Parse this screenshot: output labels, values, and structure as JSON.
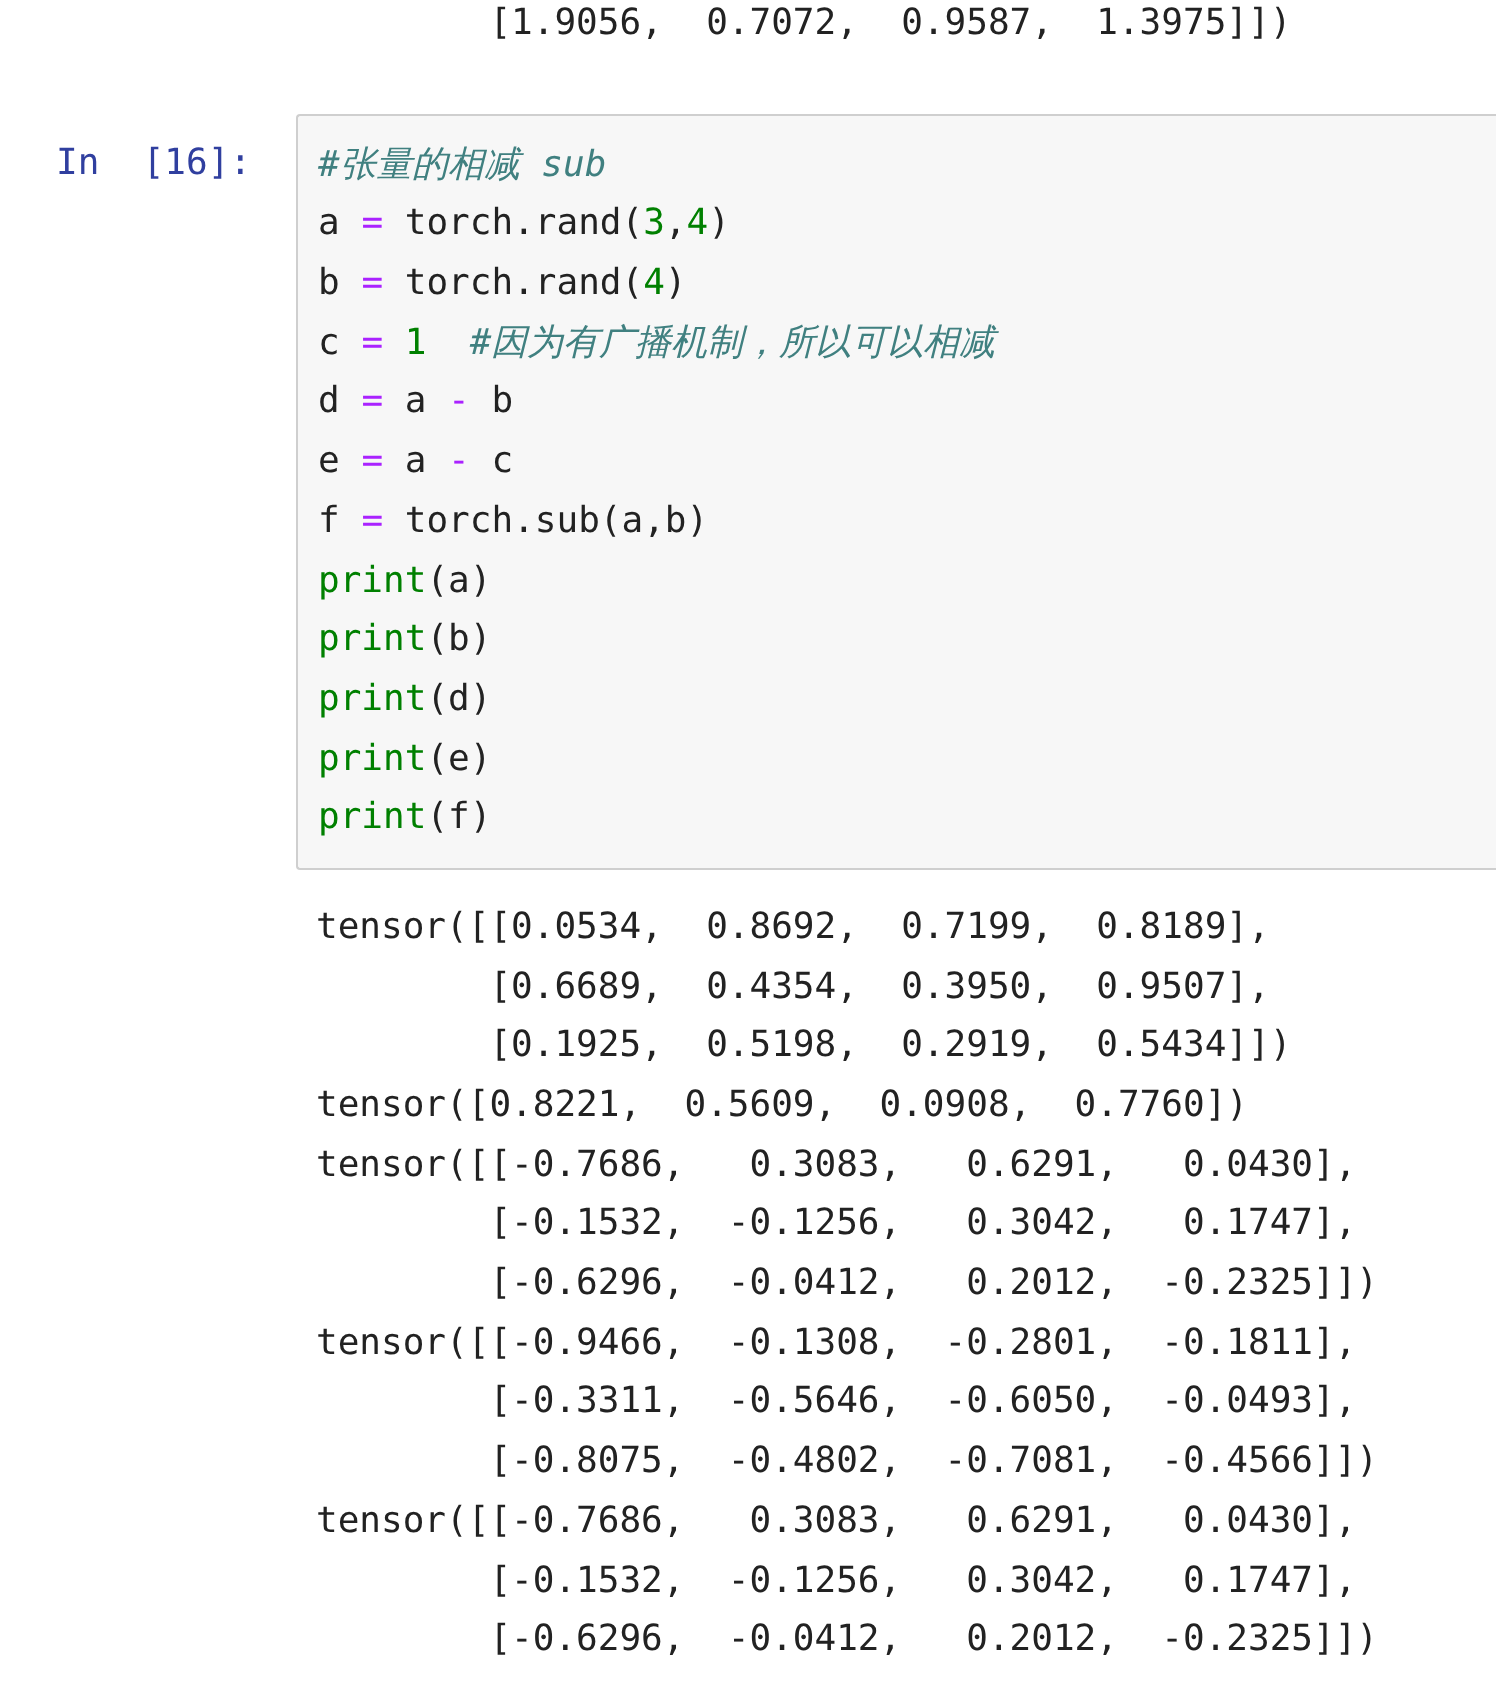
{
  "previous_output": [
    "        [1.9056,  0.7072,  0.9587,  1.3975]])"
  ],
  "cell": {
    "prompt": "In  [16]:",
    "code": [
      [
        {
          "kind": "comment",
          "text": "#张量的相减 sub"
        }
      ],
      [
        {
          "kind": "name",
          "text": "a "
        },
        {
          "kind": "op",
          "text": "="
        },
        {
          "kind": "name",
          "text": " torch.rand("
        },
        {
          "kind": "num",
          "text": "3"
        },
        {
          "kind": "name",
          "text": ","
        },
        {
          "kind": "num",
          "text": "4"
        },
        {
          "kind": "name",
          "text": ")"
        }
      ],
      [
        {
          "kind": "name",
          "text": "b "
        },
        {
          "kind": "op",
          "text": "="
        },
        {
          "kind": "name",
          "text": " torch.rand("
        },
        {
          "kind": "num",
          "text": "4"
        },
        {
          "kind": "name",
          "text": ")"
        }
      ],
      [
        {
          "kind": "name",
          "text": "c "
        },
        {
          "kind": "op",
          "text": "= "
        },
        {
          "kind": "num",
          "text": "1  "
        },
        {
          "kind": "comment",
          "text": "#因为有广播机制，所以可以相减"
        }
      ],
      [
        {
          "kind": "name",
          "text": "d "
        },
        {
          "kind": "op",
          "text": "="
        },
        {
          "kind": "name",
          "text": " a "
        },
        {
          "kind": "op",
          "text": "-"
        },
        {
          "kind": "name",
          "text": " b"
        }
      ],
      [
        {
          "kind": "name",
          "text": "e "
        },
        {
          "kind": "op",
          "text": "="
        },
        {
          "kind": "name",
          "text": " a "
        },
        {
          "kind": "op",
          "text": "-"
        },
        {
          "kind": "name",
          "text": " c"
        }
      ],
      [
        {
          "kind": "name",
          "text": "f "
        },
        {
          "kind": "op",
          "text": "="
        },
        {
          "kind": "name",
          "text": " torch.sub(a,b)"
        }
      ],
      [
        {
          "kind": "builtin",
          "text": "print"
        },
        {
          "kind": "name",
          "text": "(a)"
        }
      ],
      [
        {
          "kind": "builtin",
          "text": "print"
        },
        {
          "kind": "name",
          "text": "(b)"
        }
      ],
      [
        {
          "kind": "builtin",
          "text": "print"
        },
        {
          "kind": "name",
          "text": "(d)"
        }
      ],
      [
        {
          "kind": "builtin",
          "text": "print"
        },
        {
          "kind": "name",
          "text": "(e)"
        }
      ],
      [
        {
          "kind": "builtin",
          "text": "print"
        },
        {
          "kind": "name",
          "text": "(f)"
        }
      ]
    ],
    "output": [
      "tensor([[0.0534,  0.8692,  0.7199,  0.8189],",
      "        [0.6689,  0.4354,  0.3950,  0.9507],",
      "        [0.1925,  0.5198,  0.2919,  0.5434]])",
      "tensor([0.8221,  0.5609,  0.0908,  0.7760])",
      "tensor([[-0.7686,   0.3083,   0.6291,   0.0430],",
      "        [-0.1532,  -0.1256,   0.3042,   0.1747],",
      "        [-0.6296,  -0.0412,   0.2012,  -0.2325]])",
      "tensor([[-0.9466,  -0.1308,  -0.2801,  -0.1811],",
      "        [-0.3311,  -0.5646,  -0.6050,  -0.0493],",
      "        [-0.8075,  -0.4802,  -0.7081,  -0.4566]])",
      "tensor([[-0.7686,   0.3083,   0.6291,   0.0430],",
      "        [-0.1532,  -0.1256,   0.3042,   0.1747],",
      "        [-0.6296,  -0.0412,   0.2012,  -0.2325]])"
    ]
  }
}
